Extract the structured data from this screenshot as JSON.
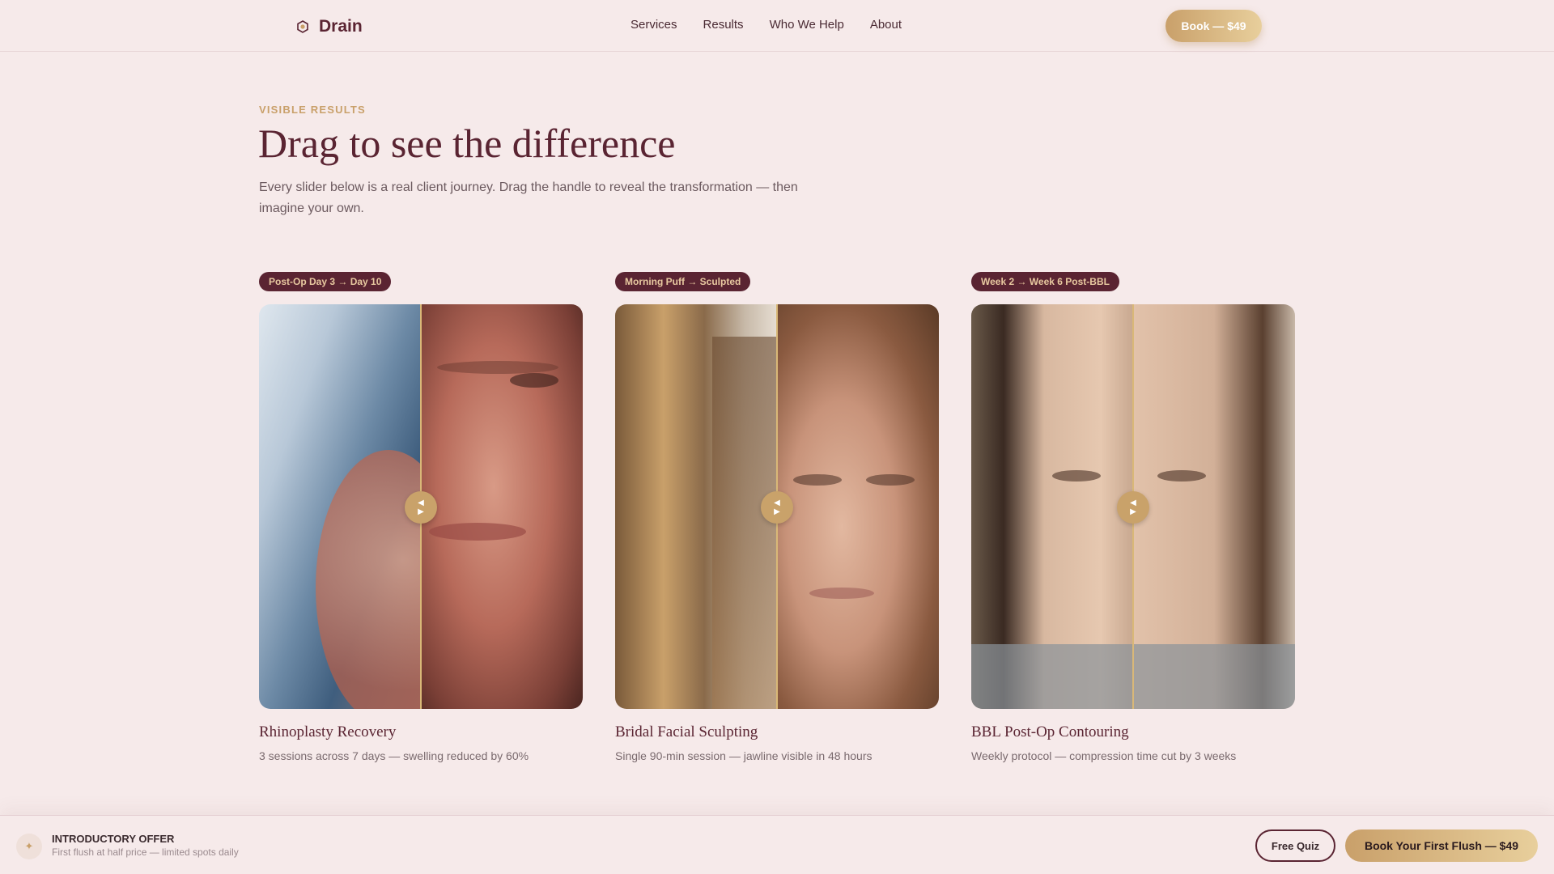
{
  "brand": {
    "name": "Drain",
    "icon": "hexagon-logo-icon"
  },
  "nav": [
    "Services",
    "Results",
    "Who We Help",
    "About"
  ],
  "header_cta": "Book — $49",
  "hero": {
    "eyebrow": "VISIBLE RESULTS",
    "title": "Drag to see the difference",
    "subtitle": "Every slider below is a real client journey. Drag the handle to reveal the transformation — then imagine your own."
  },
  "cards": [
    {
      "tag": "Post-Op Day 3 → Day 10",
      "title": "Rhinoplasty Recovery",
      "desc": "3 sessions across 7 days — swelling reduced by 60%",
      "slider_position": 0.5
    },
    {
      "tag": "Morning Puff → Sculpted",
      "title": "Bridal Facial Sculpting",
      "desc": "Single 90-min session — jawline visible in 48 hours",
      "slider_position": 0.5
    },
    {
      "tag": "Week 2 → Week 6 Post-BBL",
      "title": "BBL Post-Op Contouring",
      "desc": "Weekly protocol — compression time cut by 3 weeks",
      "slider_position": 0.5
    }
  ],
  "bottom_bar": {
    "offer_title": "INTRODUCTORY OFFER",
    "offer_sub": "First flush at half price — limited spots daily",
    "quiz_label": "Free Quiz",
    "book_label": "Book Your First Flush — $49"
  },
  "colors": {
    "background": "#f6eaea",
    "brand": "#5a2432",
    "accent_gold": "#c9a06a"
  }
}
